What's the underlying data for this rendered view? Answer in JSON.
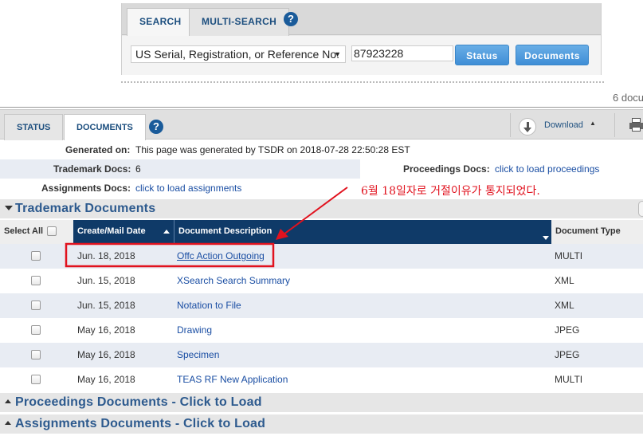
{
  "search_panel": {
    "tabs": [
      {
        "label": "SEARCH",
        "active": true
      },
      {
        "label": "MULTI-SEARCH",
        "active": false
      }
    ],
    "help_label": "?",
    "type_select": {
      "selected": "US Serial, Registration, or Reference No."
    },
    "number_input": {
      "value": "87923228"
    },
    "status_button": "Status",
    "documents_button": "Documents"
  },
  "doc_count_text": "6 docu",
  "main_tabs": {
    "tabs": [
      {
        "label": "STATUS",
        "active": false
      },
      {
        "label": "DOCUMENTS",
        "active": true
      }
    ],
    "help_label": "?",
    "download_label": "Download"
  },
  "info": {
    "generated_label": "Generated on:",
    "generated_value": "This page was generated by TSDR on 2018-07-28 22:50:28 EST",
    "trademark_docs_label": "Trademark Docs:",
    "trademark_docs_value": "6",
    "proceedings_docs_label": "Proceedings Docs:",
    "proceedings_docs_link": "click to load proceedings",
    "assignments_docs_label": "Assignments Docs:",
    "assignments_docs_link": "click to load assignments"
  },
  "sections": {
    "trademark": "Trademark Documents",
    "proceedings": "Proceedings Documents - Click to Load",
    "assignments": "Assignments Documents - Click to Load"
  },
  "annotation": {
    "text": "6월 18일자로 거절이유가 통지되었다.",
    "color": "#e1121e"
  },
  "table": {
    "headers": {
      "select_all": "Select All",
      "date": "Create/Mail Date",
      "description": "Document Description",
      "type": "Document Type"
    },
    "rows": [
      {
        "date": "Jun. 18, 2018",
        "description": "Offc Action Outgoing",
        "type": "MULTI"
      },
      {
        "date": "Jun. 15, 2018",
        "description": "XSearch Search Summary",
        "type": "XML"
      },
      {
        "date": "Jun. 15, 2018",
        "description": "Notation to File",
        "type": "XML"
      },
      {
        "date": "May 16, 2018",
        "description": "Drawing",
        "type": "JPEG"
      },
      {
        "date": "May 16, 2018",
        "description": "Specimen",
        "type": "JPEG"
      },
      {
        "date": "May 16, 2018",
        "description": "TEAS RF New Application",
        "type": "MULTI"
      }
    ]
  },
  "colors": {
    "header_navy": "#0f3a68",
    "link_blue": "#1a4ea3",
    "section_title": "#2d5a8e",
    "button_blue": "#4a97dc",
    "row_stripe": "#e8ecf3"
  }
}
